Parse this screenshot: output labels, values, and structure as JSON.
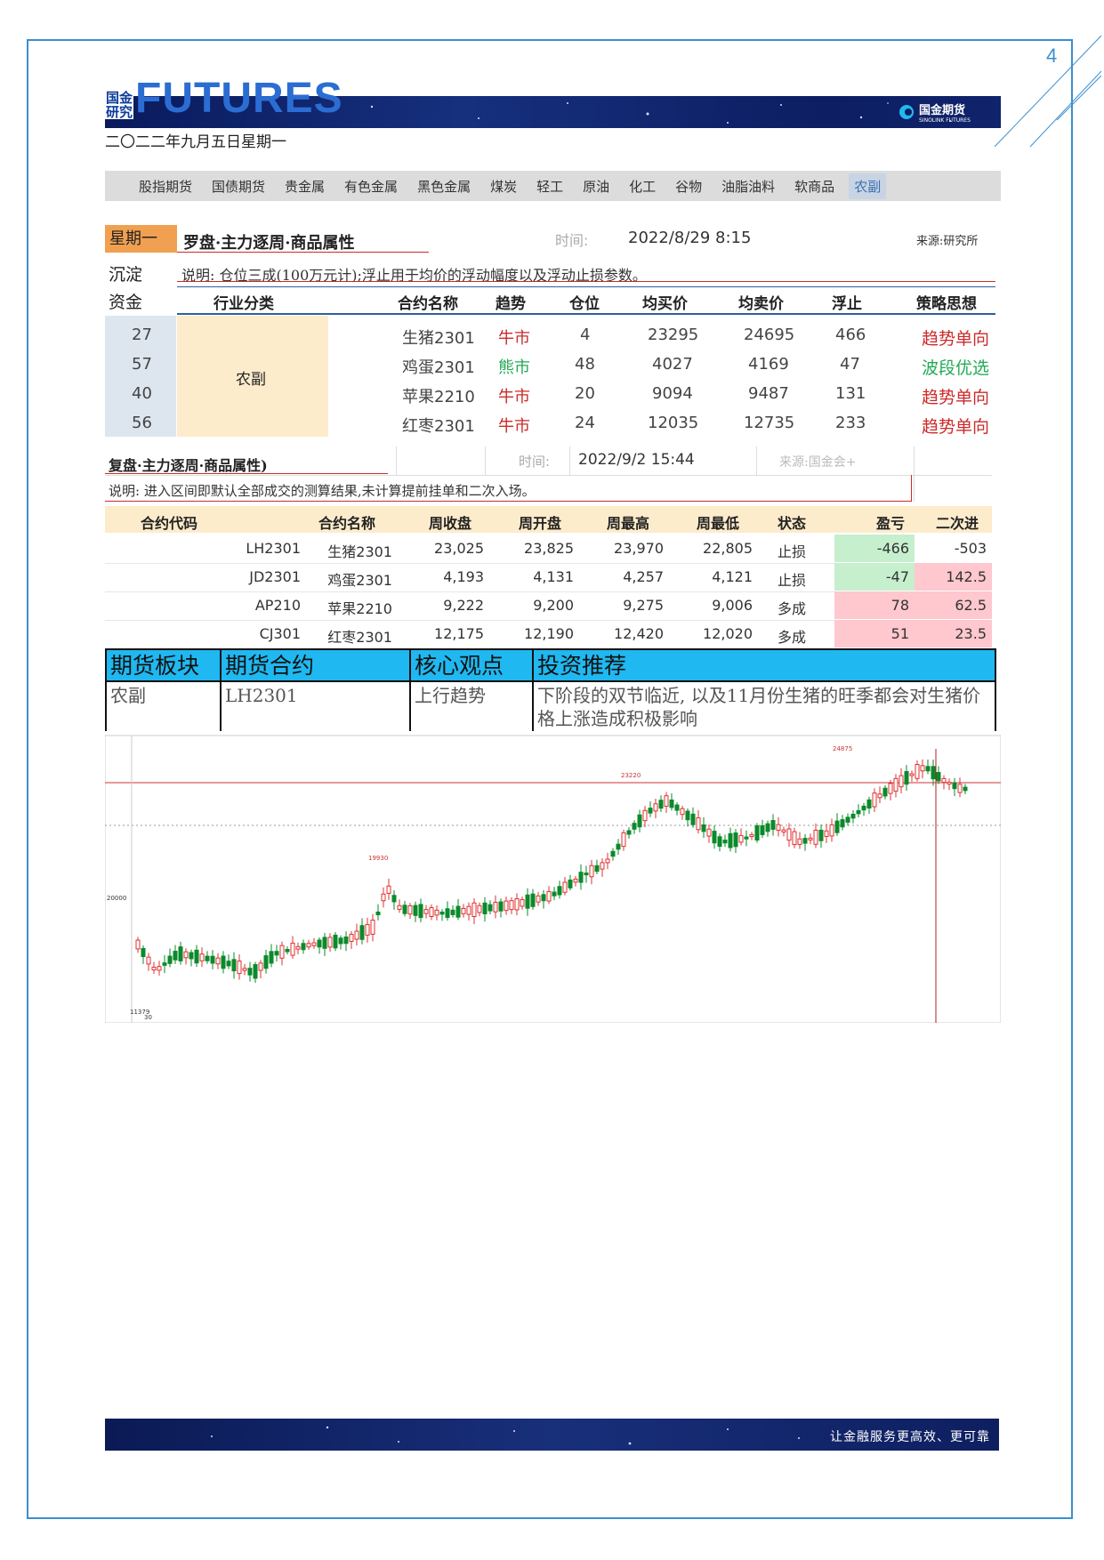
{
  "page_number": "4",
  "logo": {
    "small_top": "国金",
    "small_bottom": "研究",
    "big": "FUTURES",
    "brand": "国金期货",
    "brand_en": "SINOLINK FUTURES"
  },
  "date": "二〇二二年九月五日星期一",
  "nav": [
    "股指期货",
    "国债期货",
    "贵金属",
    "有色金属",
    "黑色金属",
    "煤炭",
    "轻工",
    "原油",
    "化工",
    "谷物",
    "油脂油料",
    "软商品",
    "农副"
  ],
  "table1": {
    "weekday": "星期一",
    "title": "罗盘·主力逐周·商品属性",
    "time_label": "时间:",
    "time": "2022/8/29 8:15",
    "source": "来源:研究所",
    "left_labels": [
      "沉淀",
      "资金"
    ],
    "note": "说明: 仓位三成(100万元计);浮止用于均价的浮动幅度以及浮动止损参数。",
    "headers": [
      "行业分类",
      "合约名称",
      "趋势",
      "仓位",
      "均买价",
      "均卖价",
      "浮止",
      "策略思想"
    ],
    "sector": "农副",
    "rows": [
      {
        "fund": "27",
        "name": "生猪2301",
        "trend": "牛市",
        "pos": "4",
        "buy": "23295",
        "sell": "24695",
        "stop": "466",
        "strategy": "趋势单向"
      },
      {
        "fund": "57",
        "name": "鸡蛋2301",
        "trend": "熊市",
        "pos": "48",
        "buy": "4027",
        "sell": "4169",
        "stop": "47",
        "strategy": "波段优选"
      },
      {
        "fund": "40",
        "name": "苹果2210",
        "trend": "牛市",
        "pos": "20",
        "buy": "9094",
        "sell": "9487",
        "stop": "131",
        "strategy": "趋势单向"
      },
      {
        "fund": "56",
        "name": "红枣2301",
        "trend": "牛市",
        "pos": "24",
        "buy": "12035",
        "sell": "12735",
        "stop": "233",
        "strategy": "趋势单向"
      }
    ]
  },
  "table2": {
    "title": "复盘·主力逐周·商品属性)",
    "time_label": "时间:",
    "time": "2022/9/2 15:44",
    "source": "来源:国金会+",
    "note": "说明: 进入区间即默认全部成交的测算结果,未计算提前挂单和二次入场。",
    "headers": [
      "合约代码",
      "合约名称",
      "周收盘",
      "周开盘",
      "周最高",
      "周最低",
      "状态",
      "盈亏",
      "二次进"
    ],
    "rows": [
      {
        "code": "LH2301",
        "name": "生猪2301",
        "close": "23,025",
        "open": "23,825",
        "high": "23,970",
        "low": "22,805",
        "state": "止损",
        "pnl": "-466",
        "second": "-503"
      },
      {
        "code": "JD2301",
        "name": "鸡蛋2301",
        "close": "4,193",
        "open": "4,131",
        "high": "4,257",
        "low": "4,121",
        "state": "止损",
        "pnl": "-47",
        "second": "142.5"
      },
      {
        "code": "AP210",
        "name": "苹果2210",
        "close": "9,222",
        "open": "9,200",
        "high": "9,275",
        "low": "9,006",
        "state": "多成",
        "pnl": "78",
        "second": "62.5"
      },
      {
        "code": "CJ301",
        "name": "红枣2301",
        "close": "12,175",
        "open": "12,190",
        "high": "12,420",
        "low": "12,020",
        "state": "多成",
        "pnl": "51",
        "second": "23.5"
      }
    ]
  },
  "recommend": {
    "headers": [
      "期货板块",
      "期货合约",
      "核心观点",
      "投资推荐"
    ],
    "sector": "农副",
    "contract": "LH2301",
    "view": "上行趋势",
    "advice": "下阶段的双节临近, 以及11月份生猪的旺季都会对生猪价格上涨造成积极影响"
  },
  "chart": {
    "label_high": "23220",
    "label_mid": "20000",
    "label_low": "11379",
    "label_low2": "30",
    "label_peak2": "24875",
    "label_mid2": "19930"
  },
  "footer": "让金融服务更高效、更可靠",
  "colors": {
    "up": "#e03030",
    "down": "#0a8a2a",
    "accent": "#1fb8f0"
  }
}
